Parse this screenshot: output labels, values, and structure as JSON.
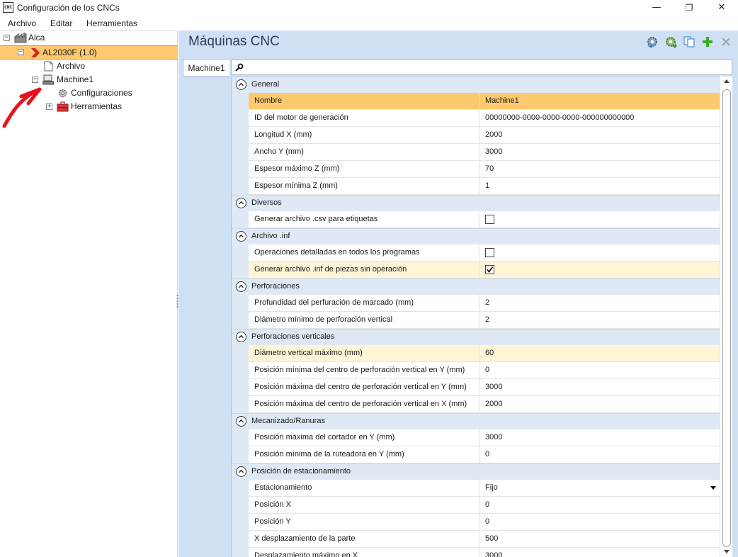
{
  "window": {
    "icon_text": "CNC",
    "title": "Configuración de los CNCs",
    "minimize": "—",
    "restore": "❐",
    "close": "✕"
  },
  "menu": [
    "Archivo",
    "Editar",
    "Herramientas"
  ],
  "tree": {
    "root": "Alca",
    "selected_node": "AL2030F (1.0)",
    "children": [
      "Archivo",
      "Machine1",
      "Configuraciones",
      "Herramientas"
    ]
  },
  "panel": {
    "title": "Máquinas CNC",
    "tab": "Machine1",
    "search_value": ""
  },
  "grid": {
    "general": {
      "label": "General",
      "rows": [
        {
          "name": "Nombre",
          "value": "Machine1"
        },
        {
          "name": "ID del motor de generación",
          "value": "00000000-0000-0000-0000-000000000000"
        },
        {
          "name": "Longitud X (mm)",
          "value": "2000"
        },
        {
          "name": "Ancho Y (mm)",
          "value": "3000"
        },
        {
          "name": "Espesor máximo Z (mm)",
          "value": "70"
        },
        {
          "name": "Espesor mínima Z (mm)",
          "value": "1"
        }
      ]
    },
    "diversos": {
      "label": "Diversos",
      "rows": [
        {
          "name": "Generar archivo .csv para etiquetas",
          "checked": false
        }
      ]
    },
    "archivo_inf": {
      "label": "Archivo .inf",
      "rows": [
        {
          "name": "Operaciones detalladas en todos los programas",
          "checked": false
        },
        {
          "name": "Generar archivo .inf de piezas sin operación",
          "checked": true
        }
      ]
    },
    "perforaciones": {
      "label": "Perforaciones",
      "rows": [
        {
          "name": "Profundidad del perfuración de marcado (mm)",
          "value": "2"
        },
        {
          "name": "Diámetro mínimo de perforación vertical",
          "value": "2"
        }
      ]
    },
    "perforaciones_verticales": {
      "label": "Perforaciones verticales",
      "rows": [
        {
          "name": "Diámetro vertical máximo (mm)",
          "value": "60"
        },
        {
          "name": "Posición mínima del centro de perforación vertical en Y (mm)",
          "value": "0"
        },
        {
          "name": "Posición máxima del centro de perforación vertical en Y (mm)",
          "value": "3000"
        },
        {
          "name": "Posición máxima del centro de perforación vertical en X (mm)",
          "value": "2000"
        }
      ]
    },
    "mecanizado": {
      "label": "Mecanizado/Ranuras",
      "rows": [
        {
          "name": "Posición máxima del cortador en Y (mm)",
          "value": "3000"
        },
        {
          "name": "Posición mínima de la ruteadora en Y (mm)",
          "value": "0"
        }
      ]
    },
    "estacionamiento": {
      "label": "Posición de estacionamiento",
      "rows": [
        {
          "name": "Estacionamiento",
          "value": "Fijo"
        },
        {
          "name": "Posición X",
          "value": "0"
        },
        {
          "name": "Posición Y",
          "value": "0"
        },
        {
          "name": "X desplazamiento de la parte",
          "value": "500"
        },
        {
          "name": "Desplazamiento máximo en X",
          "value": "3000"
        }
      ]
    }
  },
  "colors": {
    "selection": "#fcc96f",
    "hover_row": "#fdf5d6",
    "panel_bg": "#cfe0f4",
    "category_bg": "#dfe9f6",
    "arrow": "#e8141b"
  }
}
